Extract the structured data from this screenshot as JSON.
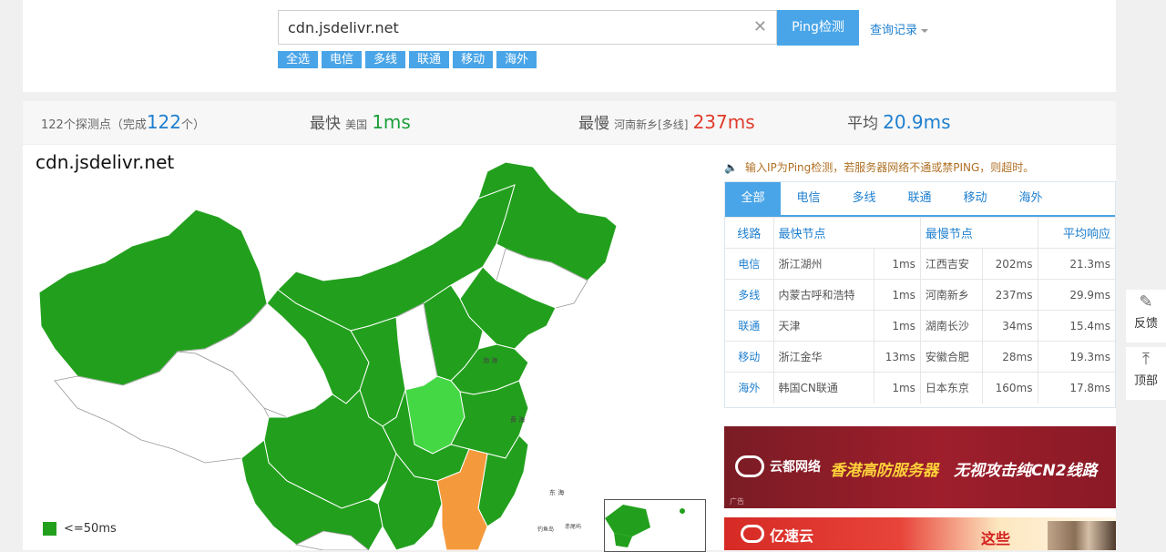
{
  "search": {
    "value": "cdn.jsdelivr.net",
    "clear_icon": "close-icon",
    "ping_button": "Ping检测",
    "history_link": "查询记录"
  },
  "filters": [
    "全选",
    "电信",
    "多线",
    "联通",
    "移动",
    "海外"
  ],
  "stats": {
    "count_prefix": "122个探测点（完成",
    "count_value": "122",
    "count_suffix": "个）",
    "fastest_label": "最快",
    "fastest_location": "美国",
    "fastest_value": "1ms",
    "slowest_label": "最慢",
    "slowest_location": "河南新乡[多线]",
    "slowest_value": "237ms",
    "average_label": "平均",
    "average_value": "20.9ms"
  },
  "map": {
    "title": "cdn.jsdelivr.net",
    "legend_label": "<=50ms",
    "colors": {
      "fast": "#22a01d",
      "medium": "#44d844",
      "slow": "#f59a3c",
      "none": "#ffffff"
    }
  },
  "notice": "输入IP为Ping检测，若服务器网络不通或禁PING，则超时。",
  "results": {
    "tabs": [
      "全部",
      "电信",
      "多线",
      "联通",
      "移动",
      "海外"
    ],
    "headers": {
      "line": "线路",
      "fastest": "最快节点",
      "slowest": "最慢节点",
      "average": "平均响应"
    },
    "rows": [
      {
        "line": "电信",
        "fast_node": "浙江湖州",
        "fast_ms": "1ms",
        "slow_node": "江西吉安",
        "slow_ms": "202ms",
        "avg": "21.3ms"
      },
      {
        "line": "多线",
        "fast_node": "内蒙古呼和浩特",
        "fast_ms": "1ms",
        "slow_node": "河南新乡",
        "slow_ms": "237ms",
        "avg": "29.9ms"
      },
      {
        "line": "联通",
        "fast_node": "天津",
        "fast_ms": "1ms",
        "slow_node": "湖南长沙",
        "slow_ms": "34ms",
        "avg": "15.4ms"
      },
      {
        "line": "移动",
        "fast_node": "浙江金华",
        "fast_ms": "13ms",
        "slow_node": "安徽合肥",
        "slow_ms": "28ms",
        "avg": "19.3ms"
      },
      {
        "line": "海外",
        "fast_node": "韩国CN联通",
        "fast_ms": "1ms",
        "slow_node": "日本东京",
        "slow_ms": "160ms",
        "avg": "17.8ms"
      }
    ]
  },
  "ads": {
    "ad1_brand": "云都网络",
    "ad1_slogan1": "香港高防服务器",
    "ad1_slogan2": "无视攻击纯CN2线路",
    "ad1_label": "广告",
    "ad2_brand": "亿速云",
    "ad2_text": "这些"
  },
  "side": {
    "feedback": "反馈",
    "top": "顶部"
  }
}
